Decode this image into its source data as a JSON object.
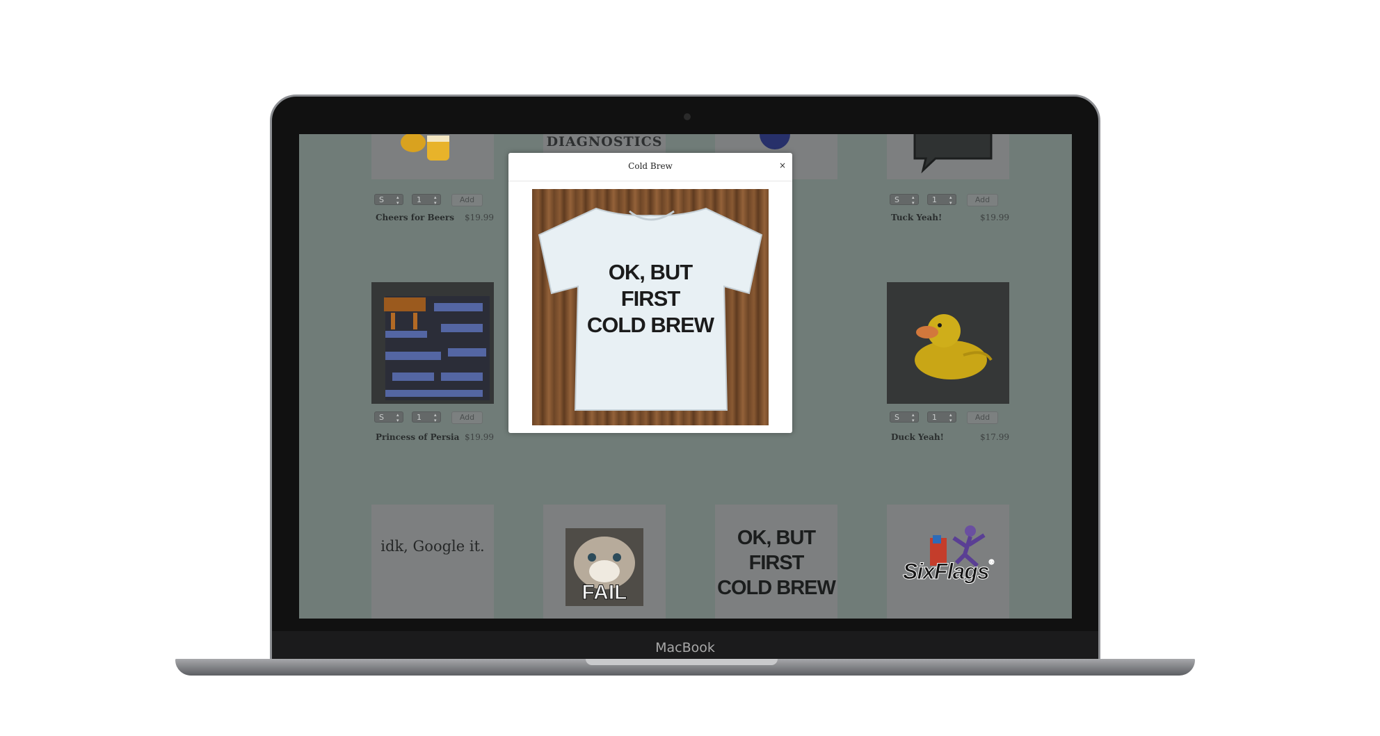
{
  "device": {
    "brand": "MacBook"
  },
  "modal": {
    "title": "Cold Brew",
    "close_symbol": "×",
    "shirt_lines": [
      "OK, BUT",
      "FIRST",
      "COLD BREW"
    ]
  },
  "products": [
    {
      "name": "Cheers for Beers",
      "price": "$19.99",
      "size": "S",
      "qty": "1",
      "add_label": "Add"
    },
    {
      "name": "Tuck Yeah!",
      "price": "$19.99",
      "size": "S",
      "qty": "1",
      "add_label": "Add"
    },
    {
      "name": "Princess of Persia",
      "price": "$19.99",
      "size": "S",
      "qty": "1",
      "add_label": "Add"
    },
    {
      "name": "Duck Yeah!",
      "price": "$17.99",
      "size": "S",
      "qty": "1",
      "add_label": "Add"
    }
  ],
  "thumb_texts": {
    "diagnostics": "DIAGNOSTICS",
    "google": "idk, Google it.",
    "fail": "FAIL",
    "cold_brew_lines": [
      "OK, BUT",
      "FIRST",
      "COLD BREW"
    ],
    "six_flags": "SixFlags",
    "six_flags_mark": "®"
  },
  "colors": {
    "overlay": "#707c78",
    "modal_bg": "#ffffff"
  }
}
